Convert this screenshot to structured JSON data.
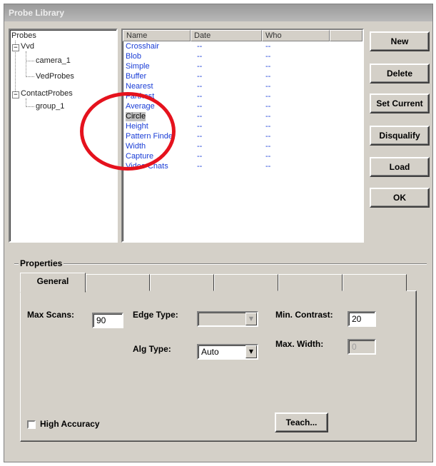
{
  "window": {
    "title": "Probe Library"
  },
  "tree": {
    "root": "Probes",
    "nodes": [
      {
        "label": "Vvd",
        "expander": "−"
      },
      {
        "label": "camera_1"
      },
      {
        "label": "VedProbes"
      },
      {
        "label": "ContactProbes",
        "expander": "−"
      },
      {
        "label": "group_1"
      }
    ]
  },
  "list": {
    "columns": [
      "Name",
      "Date",
      "Who"
    ],
    "rows": [
      {
        "name": "Crosshair",
        "date": "--",
        "who": "--"
      },
      {
        "name": "Blob",
        "date": "--",
        "who": "--"
      },
      {
        "name": "Simple",
        "date": "--",
        "who": "--"
      },
      {
        "name": "Buffer",
        "date": "--",
        "who": "--"
      },
      {
        "name": "Nearest",
        "date": "--",
        "who": "--"
      },
      {
        "name": "Farthest",
        "date": "--",
        "who": "--"
      },
      {
        "name": "Average",
        "date": "--",
        "who": "--"
      },
      {
        "name": "Circle",
        "date": "--",
        "who": "--"
      },
      {
        "name": "Height",
        "date": "--",
        "who": "--"
      },
      {
        "name": "Pattern Finder",
        "date": "--",
        "who": "--"
      },
      {
        "name": "Width",
        "date": "--",
        "who": "--"
      },
      {
        "name": "Capture",
        "date": "--",
        "who": "--"
      },
      {
        "name": "Video Chats",
        "date": "--",
        "who": "--"
      }
    ],
    "selected_row": 7
  },
  "buttons": {
    "new": "New",
    "delete": "Delete",
    "set_current": "Set Current",
    "disqualify": "Disqualify",
    "load": "Load",
    "ok": "OK"
  },
  "properties": {
    "group_label": "Properties",
    "tabs": [
      "General",
      "",
      "",
      "",
      "",
      ""
    ],
    "max_scans": {
      "label": "Max Scans:",
      "value": "90"
    },
    "edge_type": {
      "label": "Edge Type:",
      "value": ""
    },
    "min_contrast": {
      "label": "Min. Contrast:",
      "value": "20"
    },
    "alg_type": {
      "label": "Alg Type:",
      "value": "Auto"
    },
    "max_width": {
      "label": "Max. Width:",
      "value": "0"
    },
    "high_accuracy": {
      "label": "High Accuracy",
      "checked": false
    },
    "teach_button": "Teach..."
  },
  "annotation": {
    "shape": "circle",
    "color": "#e5121d"
  }
}
